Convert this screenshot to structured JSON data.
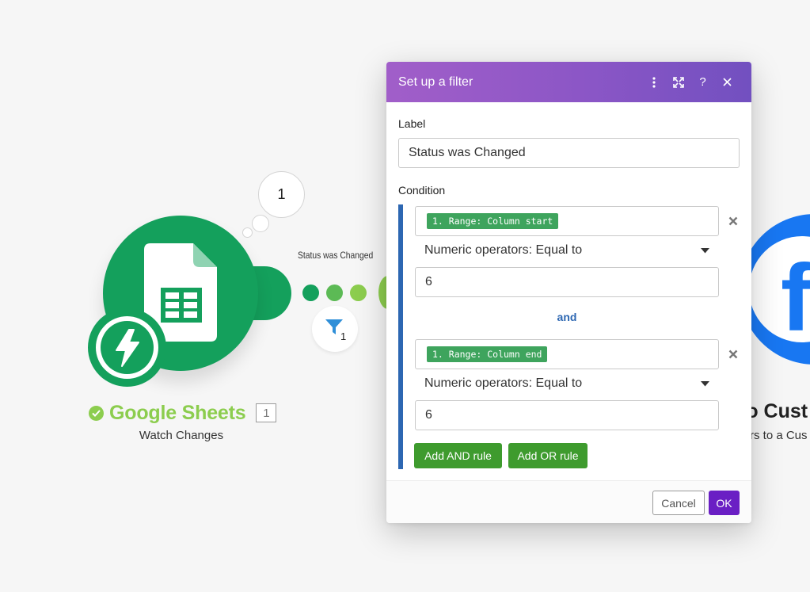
{
  "scenario": {
    "bubble_count": "1",
    "source_module": {
      "name": "Google Sheets",
      "id": "1",
      "subtitle": "Watch Changes",
      "icon": "google-sheets-icon",
      "trigger_icon": "lightning-bolt-icon",
      "status_icon": "check-circle-icon",
      "color": "#14a05c",
      "title_color": "#8ccd4e"
    },
    "route": {
      "label": "Status was Changed",
      "filter_icon": "funnel-icon",
      "filter_count": "1"
    },
    "target_module": {
      "title_partial": "to Cust",
      "subtitle_partial": "rs to a Cus",
      "icon": "facebook-icon",
      "color": "#1877f2"
    }
  },
  "dialog": {
    "title": "Set up a filter",
    "header_icons": [
      "more-vertical-icon",
      "expand-icon",
      "help-icon",
      "close-icon"
    ],
    "help_glyph": "?",
    "label": {
      "caption": "Label",
      "value": "Status was Changed"
    },
    "condition": {
      "caption": "Condition",
      "rules": [
        {
          "token": "1. Range: Column start",
          "operator": "Numeric operators: Equal to",
          "value": "6"
        },
        {
          "token": "1. Range: Column end",
          "operator": "Numeric operators: Equal to",
          "value": "6"
        }
      ],
      "joiner": "and",
      "add_and_label": "Add AND rule",
      "add_or_label": "Add OR rule"
    },
    "footer": {
      "cancel_label": "Cancel",
      "ok_label": "OK"
    },
    "colors": {
      "header_start": "#a15ec9",
      "header_end": "#7250c0",
      "token": "#3ea45d",
      "rule_bar": "#2d67b2",
      "green_button": "#3e9b2e",
      "ok_button": "#6a1fc4"
    }
  }
}
